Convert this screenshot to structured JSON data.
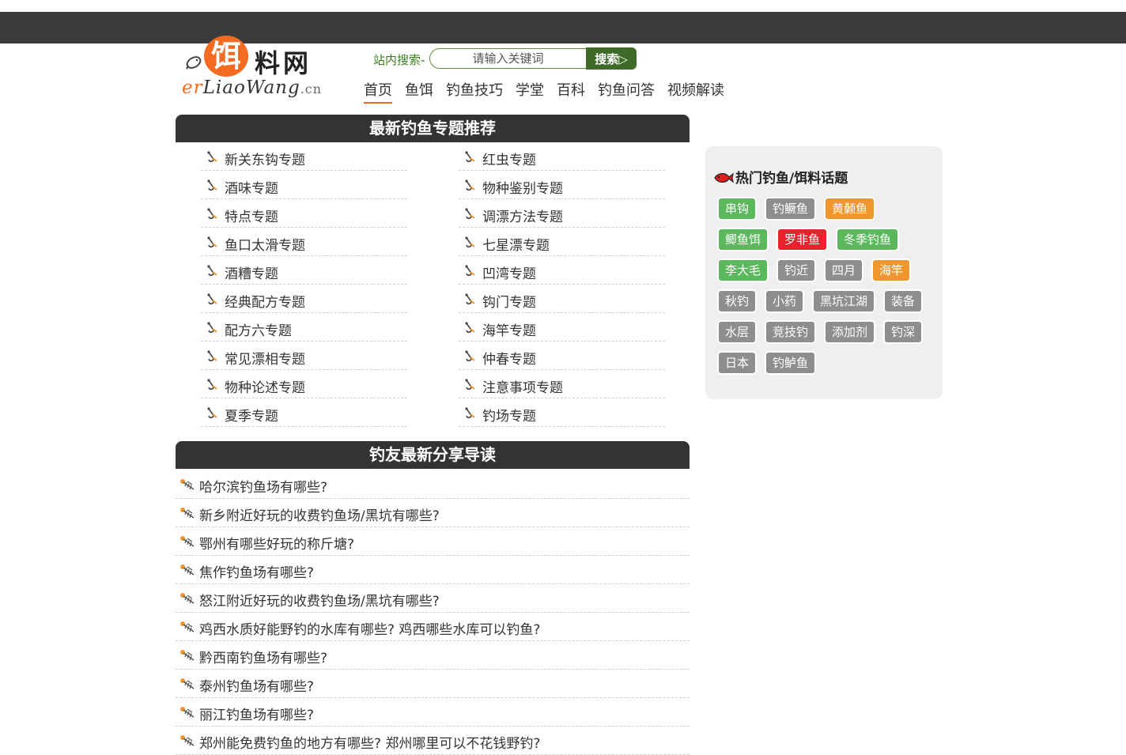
{
  "logo": {
    "glyph": "饵",
    "text_cn": "料网",
    "text_en": {
      "e": "e",
      "r": "r",
      "rest": "LiaoWang",
      "suffix": ".cn"
    }
  },
  "search": {
    "label": "站内搜索-",
    "placeholder": "请输入关键词",
    "button": "搜索▷"
  },
  "nav": [
    {
      "label": "首页",
      "active": true
    },
    {
      "label": "鱼饵"
    },
    {
      "label": "钓鱼技巧"
    },
    {
      "label": "学堂"
    },
    {
      "label": "百科"
    },
    {
      "label": "钓鱼问答"
    },
    {
      "label": "视频解读"
    }
  ],
  "topics_section": {
    "title": "最新钓鱼专题推荐",
    "left": [
      "新关东钩专题",
      "酒味专题",
      "特点专题",
      "鱼口太滑专题",
      "酒糟专题",
      "经典配方专题",
      "配方六专题",
      "常见漂相专题",
      "物种论述专题",
      "夏季专题"
    ],
    "right": [
      "红虫专题",
      "物种鉴别专题",
      "调漂方法专题",
      "七星漂专题",
      "凹湾专题",
      "钩门专题",
      "海竿专题",
      "仲春专题",
      "注意事项专题",
      "钓场专题"
    ]
  },
  "articles_section": {
    "title": "钓友最新分享导读",
    "items": [
      "哈尔滨钓鱼场有哪些?",
      "新乡附近好玩的收费钓鱼场/黑坑有哪些?",
      "鄂州有哪些好玩的称斤塘?",
      "焦作钓鱼场有哪些?",
      "怒江附近好玩的收费钓鱼场/黑坑有哪些?",
      "鸡西水质好能野钓的水库有哪些? 鸡西哪些水库可以钓鱼?",
      "黔西南钓鱼场有哪些?",
      "泰州钓鱼场有哪些?",
      "丽江钓鱼场有哪些?",
      "郑州能免费钓鱼的地方有哪些? 郑州哪里可以不花钱野钓?"
    ]
  },
  "hot_topics": {
    "title": "热门钓鱼/饵料话题",
    "tags": [
      {
        "label": "串钩",
        "color": "#5cb85c"
      },
      {
        "label": "钓鳜鱼",
        "color": "#8e8e8e"
      },
      {
        "label": "黄颡鱼",
        "color": "#f0962e"
      },
      {
        "label": "鲫鱼饵",
        "color": "#5cb85c"
      },
      {
        "label": "罗非鱼",
        "color": "#e8232d"
      },
      {
        "label": "冬季钓鱼",
        "color": "#5cb85c"
      },
      {
        "label": "李大毛",
        "color": "#5cb85c"
      },
      {
        "label": "钓近",
        "color": "#8e8e8e"
      },
      {
        "label": "四月",
        "color": "#8e8e8e"
      },
      {
        "label": "海竿",
        "color": "#f0962e"
      },
      {
        "label": "秋钓",
        "color": "#8e8e8e"
      },
      {
        "label": "小药",
        "color": "#8e8e8e"
      },
      {
        "label": "黑坑江湖",
        "color": "#8e8e8e"
      },
      {
        "label": "装备",
        "color": "#8e8e8e"
      },
      {
        "label": "水层",
        "color": "#8e8e8e"
      },
      {
        "label": "竞技钓",
        "color": "#8e8e8e"
      },
      {
        "label": "添加剂",
        "color": "#8e8e8e"
      },
      {
        "label": "钓深",
        "color": "#8e8e8e"
      },
      {
        "label": "日本",
        "color": "#8e8e8e"
      },
      {
        "label": "钓鲈鱼",
        "color": "#8e8e8e"
      }
    ]
  },
  "colors": {
    "accent": "#f26b21",
    "topbar": "#3b3b3b",
    "panel_head": "#333333",
    "search_green": "#3f6b2a"
  }
}
